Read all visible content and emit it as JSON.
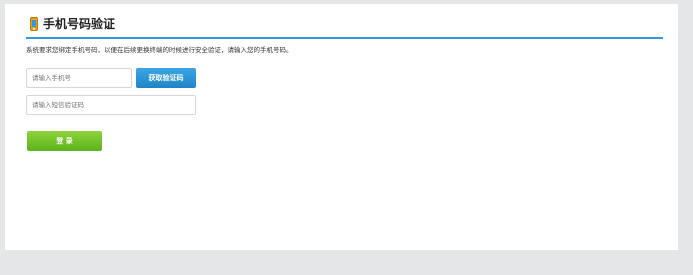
{
  "header": {
    "title": "手机号码验证",
    "icon": "mobile-phone-icon"
  },
  "description": "系统要求您绑定手机号码，以便在后续更换终端的时候进行安全验证，请输入您的手机号码。",
  "form": {
    "phone_placeholder": "请输入手机号",
    "code_placeholder": "请输入短信验证码",
    "get_code_label": "获取验证码",
    "login_label": "登 录"
  },
  "colors": {
    "accent_blue": "#2f9ad8",
    "login_green": "#6cc024",
    "page_bg": "#e5e6e8"
  }
}
